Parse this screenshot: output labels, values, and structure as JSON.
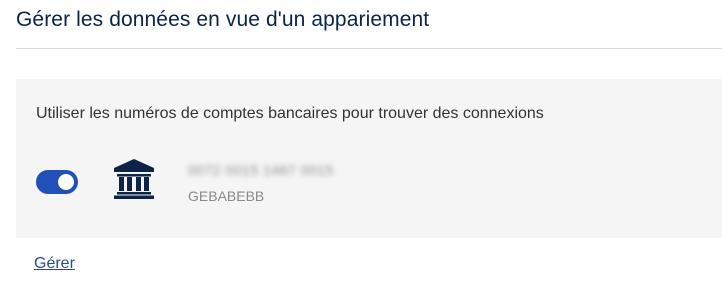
{
  "header": {
    "title": "Gérer les données en vue d'un appariement"
  },
  "panel": {
    "heading": "Utiliser les numéros de comptes bancaires pour trouver des connexions",
    "toggle_on": true,
    "account": {
      "number": "0072 0015 1487 0015",
      "bic": "GEBABEBB",
      "icon": "bank-icon"
    }
  },
  "footer": {
    "manage_label": "Gérer"
  },
  "colors": {
    "title": "#0b2448",
    "toggle": "#2250b8",
    "icon": "#0b2448",
    "link": "#2d4b8c",
    "panel_bg": "#f5f5f5"
  }
}
